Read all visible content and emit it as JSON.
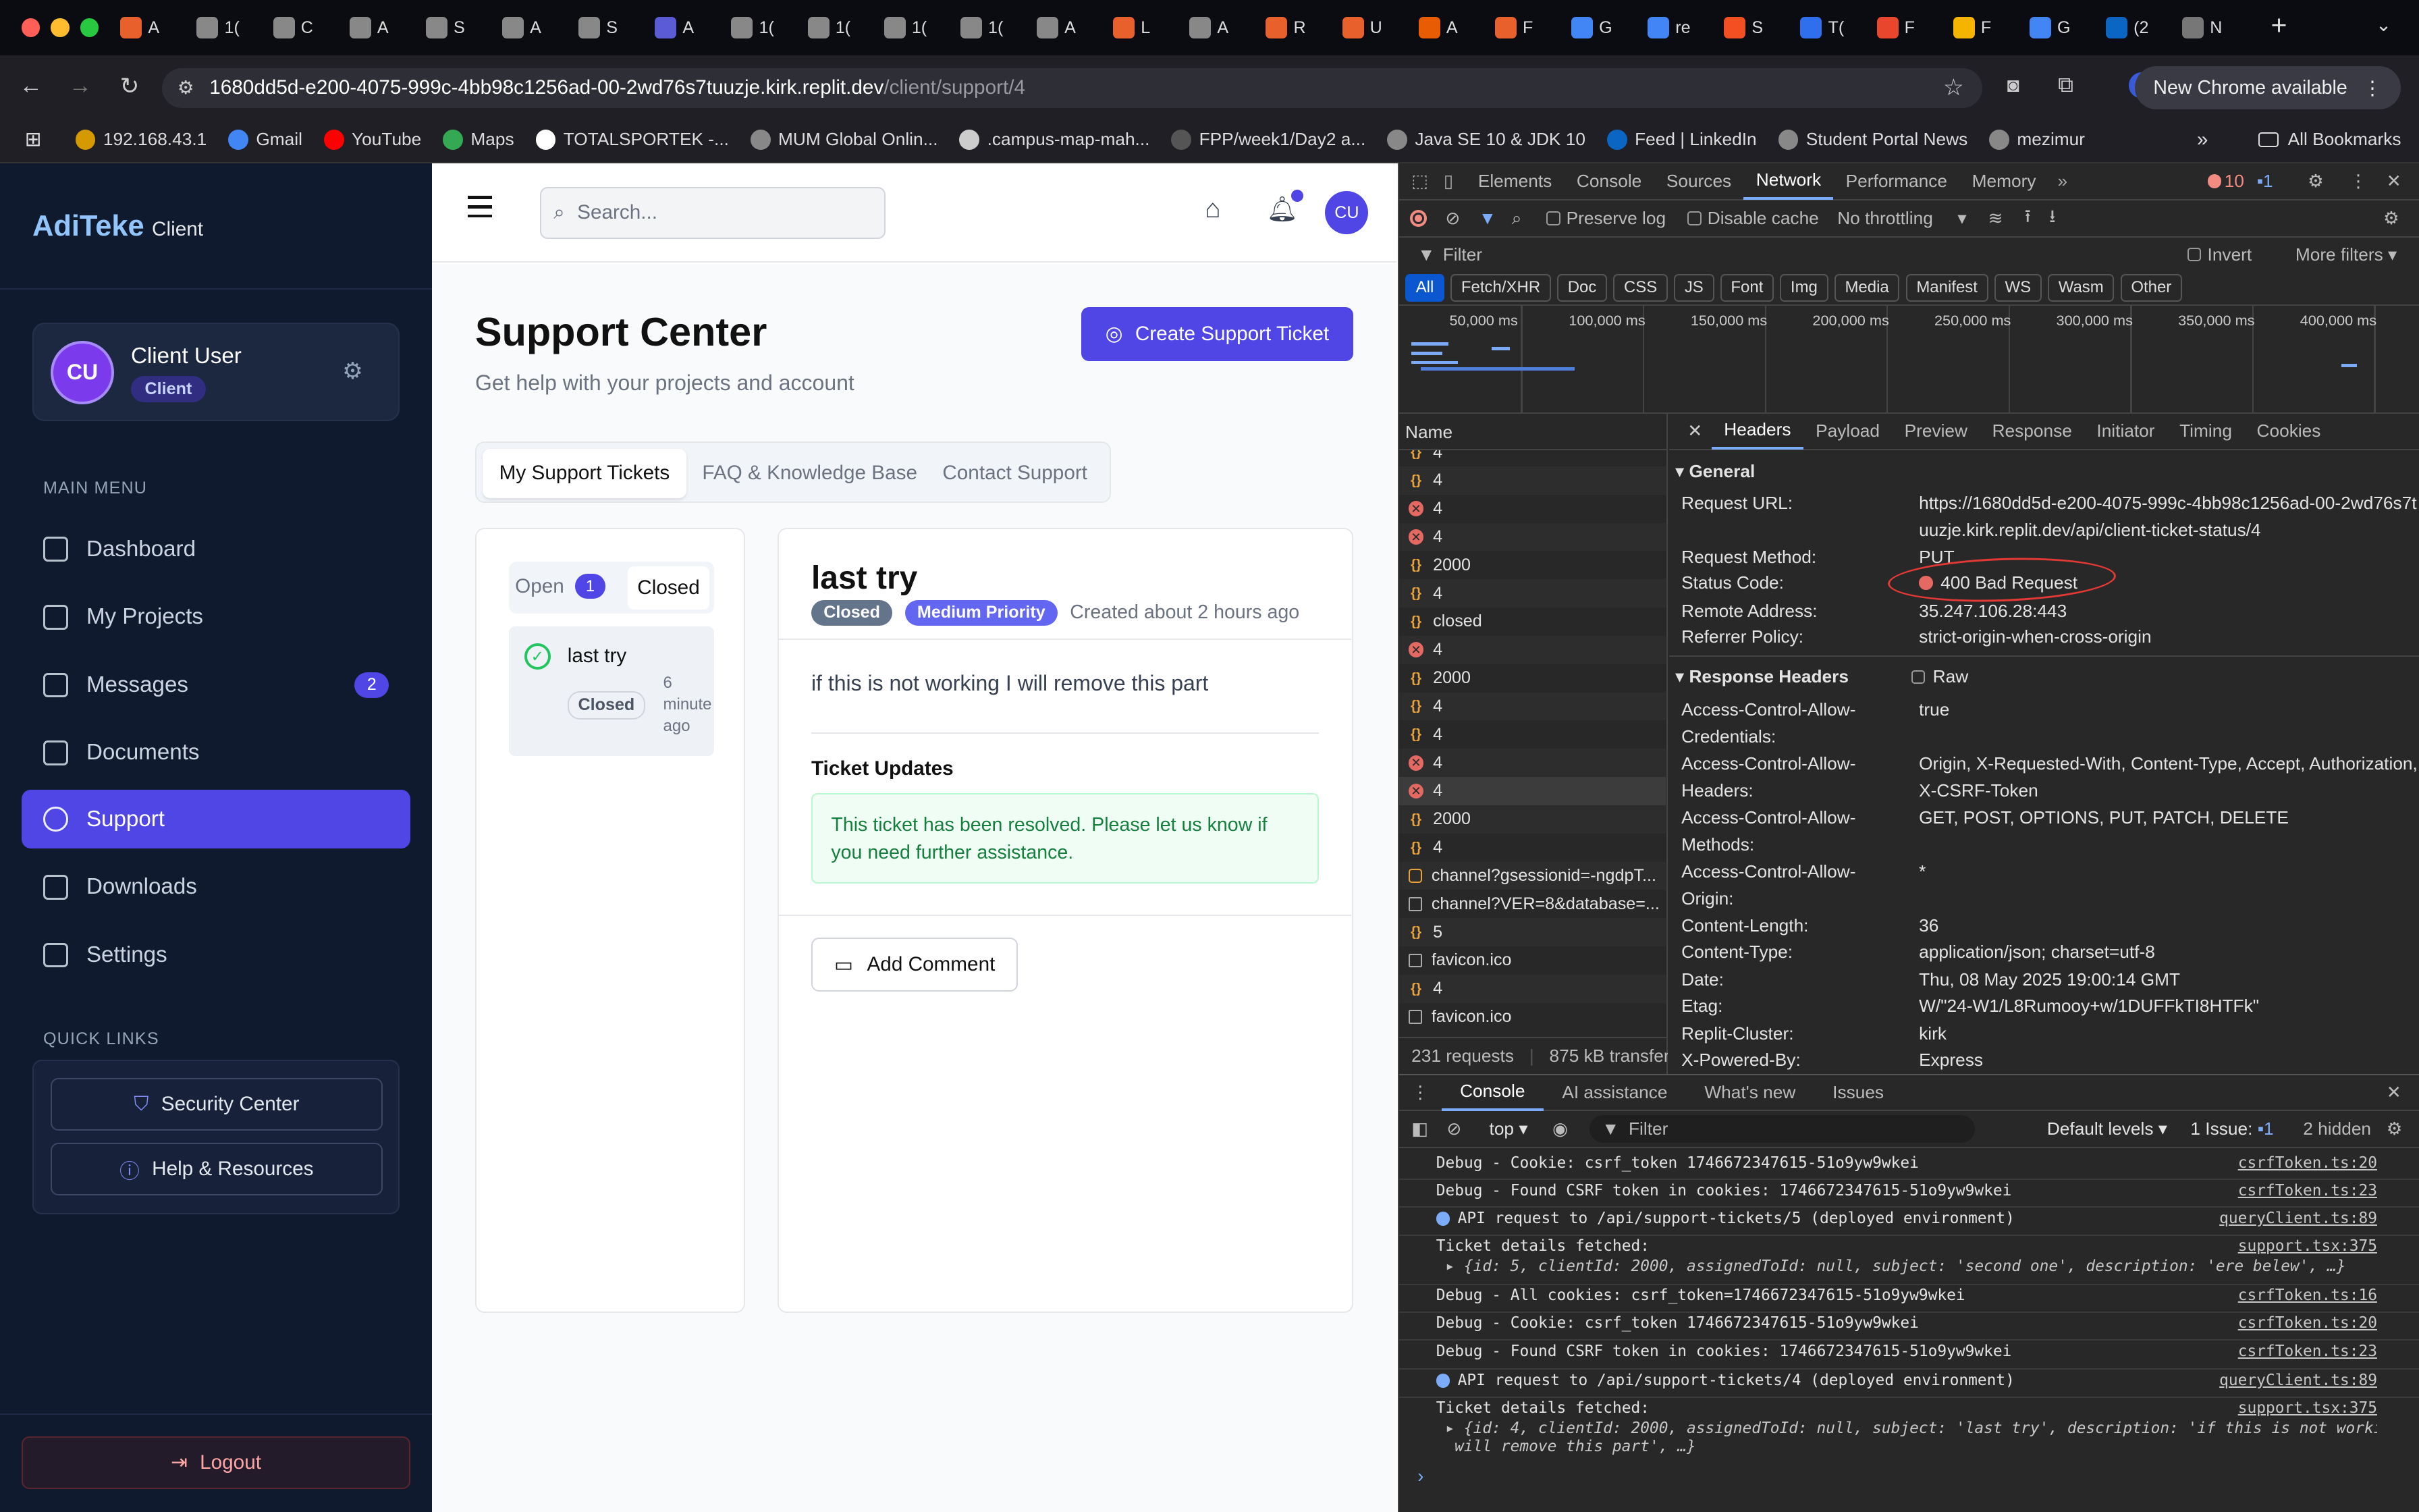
{
  "browser": {
    "tabs": [
      "A",
      "1(",
      "C",
      "A",
      "S",
      "A",
      "S",
      "A",
      "1(",
      "1(",
      "1(",
      "1(",
      "A",
      "L",
      "A",
      "R",
      "U",
      "A",
      "F",
      "G",
      "re",
      "S",
      "T(",
      "F",
      "F",
      "G",
      "(2",
      "N"
    ],
    "address_host": "1680dd5d-e200-4075-999c-4bb98c1256ad-00-2wd76s7tuuzje.kirk.replit.dev",
    "address_path": "/client/support/4",
    "new_chrome": "New Chrome available",
    "profile_initial": "A",
    "bookmarks": [
      "192.168.43.1",
      "Gmail",
      "YouTube",
      "Maps",
      "TOTALSPORTEK -...",
      "MUM Global Onlin...",
      ".campus-map-mah...",
      "FPP/week1/Day2 a...",
      "Java SE 10 & JDK 10",
      "Feed | LinkedIn",
      "Student Portal News",
      "mezimur"
    ],
    "all_bookmarks": "All Bookmarks"
  },
  "sidebar": {
    "brand": "AdiTeke",
    "brand_sub": "Client",
    "user_initials": "CU",
    "user_name": "Client User",
    "user_role": "Client",
    "main_menu_label": "MAIN MENU",
    "items": [
      {
        "label": "Dashboard"
      },
      {
        "label": "My Projects"
      },
      {
        "label": "Messages",
        "badge": "2"
      },
      {
        "label": "Documents"
      },
      {
        "label": "Support"
      },
      {
        "label": "Downloads"
      },
      {
        "label": "Settings"
      }
    ],
    "quick_links_label": "QUICK LINKS",
    "quick_links": [
      "Security Center",
      "Help & Resources"
    ],
    "logout": "Logout"
  },
  "topbar": {
    "search_placeholder": "Search...",
    "avatar": "CU"
  },
  "page": {
    "title": "Support Center",
    "subtitle": "Get help with your projects and account",
    "create_button": "Create Support Ticket",
    "tabs": [
      "My Support Tickets",
      "FAQ & Knowledge Base",
      "Contact Support"
    ],
    "filter_open": "Open",
    "filter_open_count": "1",
    "filter_closed": "Closed",
    "ticket_item": {
      "title": "last try",
      "status": "Closed",
      "age_l1": "6",
      "age_l2": "minute",
      "age_l3": "ago"
    },
    "detail": {
      "title": "last try",
      "status": "Closed",
      "priority": "Medium Priority",
      "created": "Created about 2 hours ago",
      "description": "if this is not working I will remove this part",
      "updates_heading": "Ticket Updates",
      "update_text": "This ticket has been resolved. Please let us know if you need further assistance.",
      "add_comment": "Add Comment"
    }
  },
  "devtools": {
    "panels": [
      "Elements",
      "Console",
      "Sources",
      "Network",
      "Performance",
      "Memory"
    ],
    "error_count": "10",
    "info_count": "1",
    "preserve_log": "Preserve log",
    "disable_cache": "Disable cache",
    "throttling": "No throttling",
    "filter_placeholder": "Filter",
    "invert": "Invert",
    "more_filters": "More filters",
    "type_filters": [
      "All",
      "Fetch/XHR",
      "Doc",
      "CSS",
      "JS",
      "Font",
      "Img",
      "Media",
      "Manifest",
      "WS",
      "Wasm",
      "Other"
    ],
    "timeline_ticks": [
      "50,000 ms",
      "100,000 ms",
      "150,000 ms",
      "200,000 ms",
      "250,000 ms",
      "300,000 ms",
      "350,000 ms",
      "400,000 ms"
    ],
    "name_header": "Name",
    "requests": [
      {
        "name": "4",
        "kind": "ok"
      },
      {
        "name": "4",
        "kind": "ok"
      },
      {
        "name": "4",
        "kind": "err"
      },
      {
        "name": "4",
        "kind": "err"
      },
      {
        "name": "2000",
        "kind": "ok"
      },
      {
        "name": "4",
        "kind": "ok"
      },
      {
        "name": "closed",
        "kind": "ok"
      },
      {
        "name": "4",
        "kind": "err"
      },
      {
        "name": "2000",
        "kind": "ok"
      },
      {
        "name": "4",
        "kind": "ok"
      },
      {
        "name": "4",
        "kind": "ok"
      },
      {
        "name": "4",
        "kind": "err"
      },
      {
        "name": "4",
        "kind": "err",
        "selected": true
      },
      {
        "name": "2000",
        "kind": "ok"
      },
      {
        "name": "4",
        "kind": "ok"
      },
      {
        "name": "channel?gsessionid=-ngdpT...",
        "kind": "sock"
      },
      {
        "name": "channel?VER=8&database=...",
        "kind": "doc"
      },
      {
        "name": "5",
        "kind": "ok"
      },
      {
        "name": "favicon.ico",
        "kind": "doc"
      },
      {
        "name": "4",
        "kind": "ok"
      },
      {
        "name": "favicon.ico",
        "kind": "doc"
      }
    ],
    "summary_requests": "231 requests",
    "summary_transfer": "875 kB transferre",
    "detail_tabs": [
      "Headers",
      "Payload",
      "Preview",
      "Response",
      "Initiator",
      "Timing",
      "Cookies"
    ],
    "general_label": "General",
    "general": [
      {
        "k": "Request URL:",
        "v": "https://1680dd5d-e200-4075-999c-4bb98c1256ad-00-2wd76s7tuuzje.kirk.replit.dev/api/client-ticket-status/4"
      },
      {
        "k": "Request Method:",
        "v": "PUT"
      },
      {
        "k": "Status Code:",
        "v": "400 Bad Request"
      },
      {
        "k": "Remote Address:",
        "v": "35.247.106.28:443"
      },
      {
        "k": "Referrer Policy:",
        "v": "strict-origin-when-cross-origin"
      }
    ],
    "response_headers_label": "Response Headers",
    "raw_label": "Raw",
    "response_headers": [
      {
        "k": "Access-Control-Allow-Credentials:",
        "v": "true"
      },
      {
        "k": "Access-Control-Allow-Headers:",
        "v": "Origin, X-Requested-With, Content-Type, Accept, Authorization, X-CSRF-Token"
      },
      {
        "k": "Access-Control-Allow-Methods:",
        "v": "GET, POST, OPTIONS, PUT, PATCH, DELETE"
      },
      {
        "k": "Access-Control-Allow-Origin:",
        "v": "*"
      },
      {
        "k": "Content-Length:",
        "v": "36"
      },
      {
        "k": "Content-Type:",
        "v": "application/json; charset=utf-8"
      },
      {
        "k": "Date:",
        "v": "Thu, 08 May 2025 19:00:14 GMT"
      },
      {
        "k": "Etag:",
        "v": "W/\"24-W1/L8Rumooy+w/1DUFFkTI8HTFk\""
      },
      {
        "k": "Replit-Cluster:",
        "v": "kirk"
      },
      {
        "k": "X-Powered-By:",
        "v": "Express"
      }
    ],
    "drawer_tabs": [
      "Console",
      "AI assistance",
      "What's new",
      "Issues"
    ],
    "context": "top",
    "console_filter": "Filter",
    "levels": "Default levels",
    "issues": "1 Issue:",
    "issues_count": "1",
    "hidden": "2 hidden",
    "console": [
      {
        "text": "Debug - Cookie: csrf_token 1746672347615-51o9yw9wkei",
        "src": "csrfToken.ts:20"
      },
      {
        "text": "Debug - Found CSRF token in cookies: 1746672347615-51o9yw9wkei",
        "src": "csrfToken.ts:23"
      },
      {
        "text": "API request to /api/support-tickets/5 (deployed environment)",
        "src": "queryClient.ts:89",
        "info": true
      },
      {
        "text": "Ticket details fetched:",
        "src": "support.tsx:375"
      },
      {
        "text": "{id: 5, clientId: 2000, assignedToId: null, subject: 'second one', description: 'ere belew', …}",
        "src": "",
        "obj": true
      },
      {
        "text": "Debug - All cookies: csrf_token=1746672347615-51o9yw9wkei",
        "src": "csrfToken.ts:16"
      },
      {
        "text": "Debug - Cookie: csrf_token 1746672347615-51o9yw9wkei",
        "src": "csrfToken.ts:20"
      },
      {
        "text": "Debug - Found CSRF token in cookies: 1746672347615-51o9yw9wkei",
        "src": "csrfToken.ts:23"
      },
      {
        "text": "API request to /api/support-tickets/4 (deployed environment)",
        "src": "queryClient.ts:89",
        "info": true
      },
      {
        "text": "Ticket details fetched:",
        "src": "support.tsx:375"
      },
      {
        "text": "{id: 4, clientId: 2000, assignedToId: null, subject: 'last try', description: 'if this is not working I",
        "src": "",
        "obj": true
      },
      {
        "text": "will remove this part', …}",
        "src": "",
        "obj": true
      }
    ]
  },
  "colors": {
    "accent": "#4f46e5",
    "sidebar_bg": "#101a2e",
    "annotation_red": "#e53935",
    "devtools_bg": "#282828"
  }
}
